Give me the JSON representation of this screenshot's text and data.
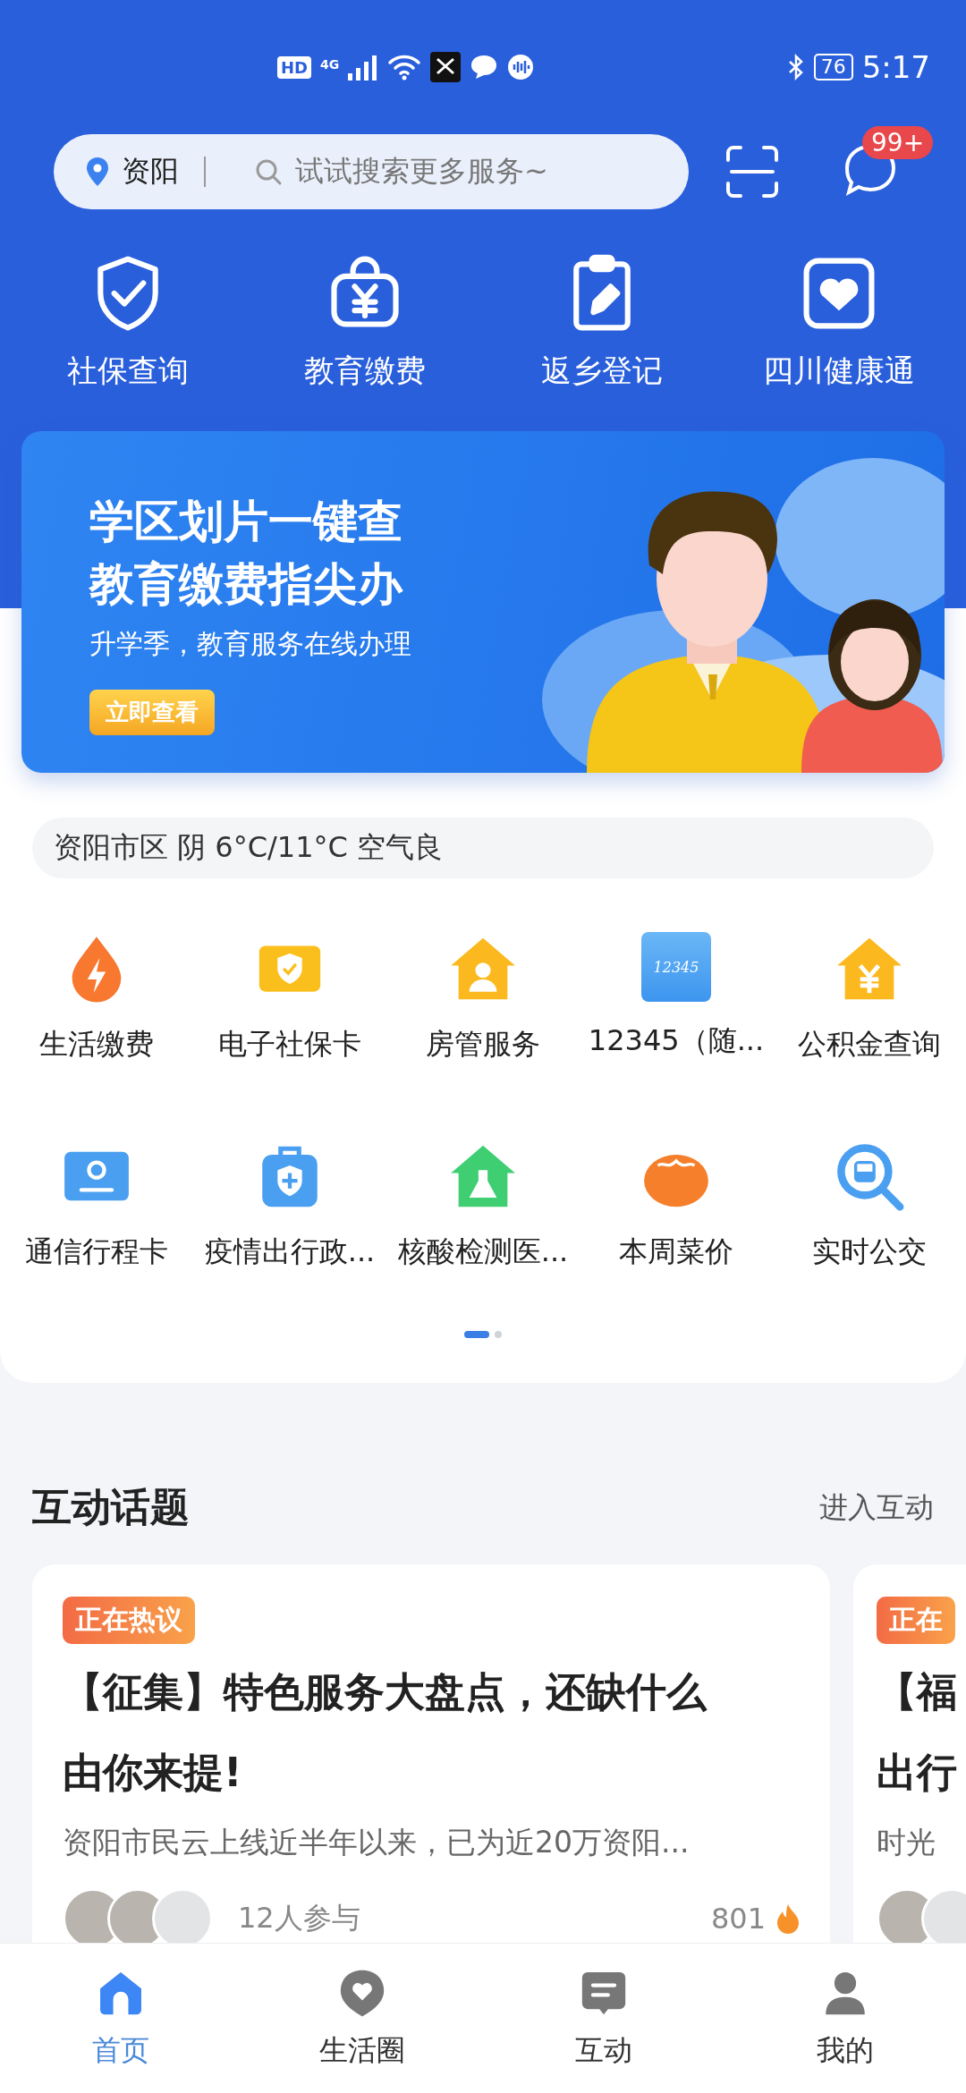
{
  "status_bar": {
    "network_labels": [
      "HD",
      "4G"
    ],
    "battery": "76",
    "time": "5:17"
  },
  "search": {
    "location": "资阳",
    "placeholder": "试试搜索更多服务~"
  },
  "message_badge": "99+",
  "quick_services": [
    {
      "label": "社保查询"
    },
    {
      "label": "教育缴费"
    },
    {
      "label": "返乡登记"
    },
    {
      "label": "四川健康通"
    }
  ],
  "banner": {
    "title_lines": [
      "学区划片一键查",
      "教育缴费指尖办"
    ],
    "subtitle": "升学季，教育服务在线办理",
    "button": "立即查看"
  },
  "weather": "资阳市区 阴 6°C/11°C 空气良",
  "services": [
    {
      "label": "生活缴费"
    },
    {
      "label": "电子社保卡"
    },
    {
      "label": "房管服务"
    },
    {
      "label": "12345（随...",
      "logo_text": "12345"
    },
    {
      "label": "公积金查询"
    },
    {
      "label": "通信行程卡"
    },
    {
      "label": "疫情出行政..."
    },
    {
      "label": "核酸检测医..."
    },
    {
      "label": "本周菜价"
    },
    {
      "label": "实时公交"
    }
  ],
  "pager": [
    {
      "selected": true
    },
    {
      "selected": false
    }
  ],
  "topics": {
    "title": "互动话题",
    "more": "进入互动",
    "cards": [
      {
        "tag": "正在热议",
        "title_lines": [
          "【征集】特色服务大盘点，还缺什么",
          "由你来提!"
        ],
        "summary": "资阳市民云上线近半年以来，已为近20万资阳...",
        "participants": "12人参与",
        "heat": "801"
      },
      {
        "tag": "正在",
        "title_lines": [
          "【福",
          "出行"
        ],
        "summary": "时光"
      }
    ]
  },
  "tab_bar": [
    {
      "label": "首页",
      "selected": true
    },
    {
      "label": "生活圈",
      "selected": false
    },
    {
      "label": "互动",
      "selected": false
    },
    {
      "label": "我的",
      "selected": false
    }
  ]
}
